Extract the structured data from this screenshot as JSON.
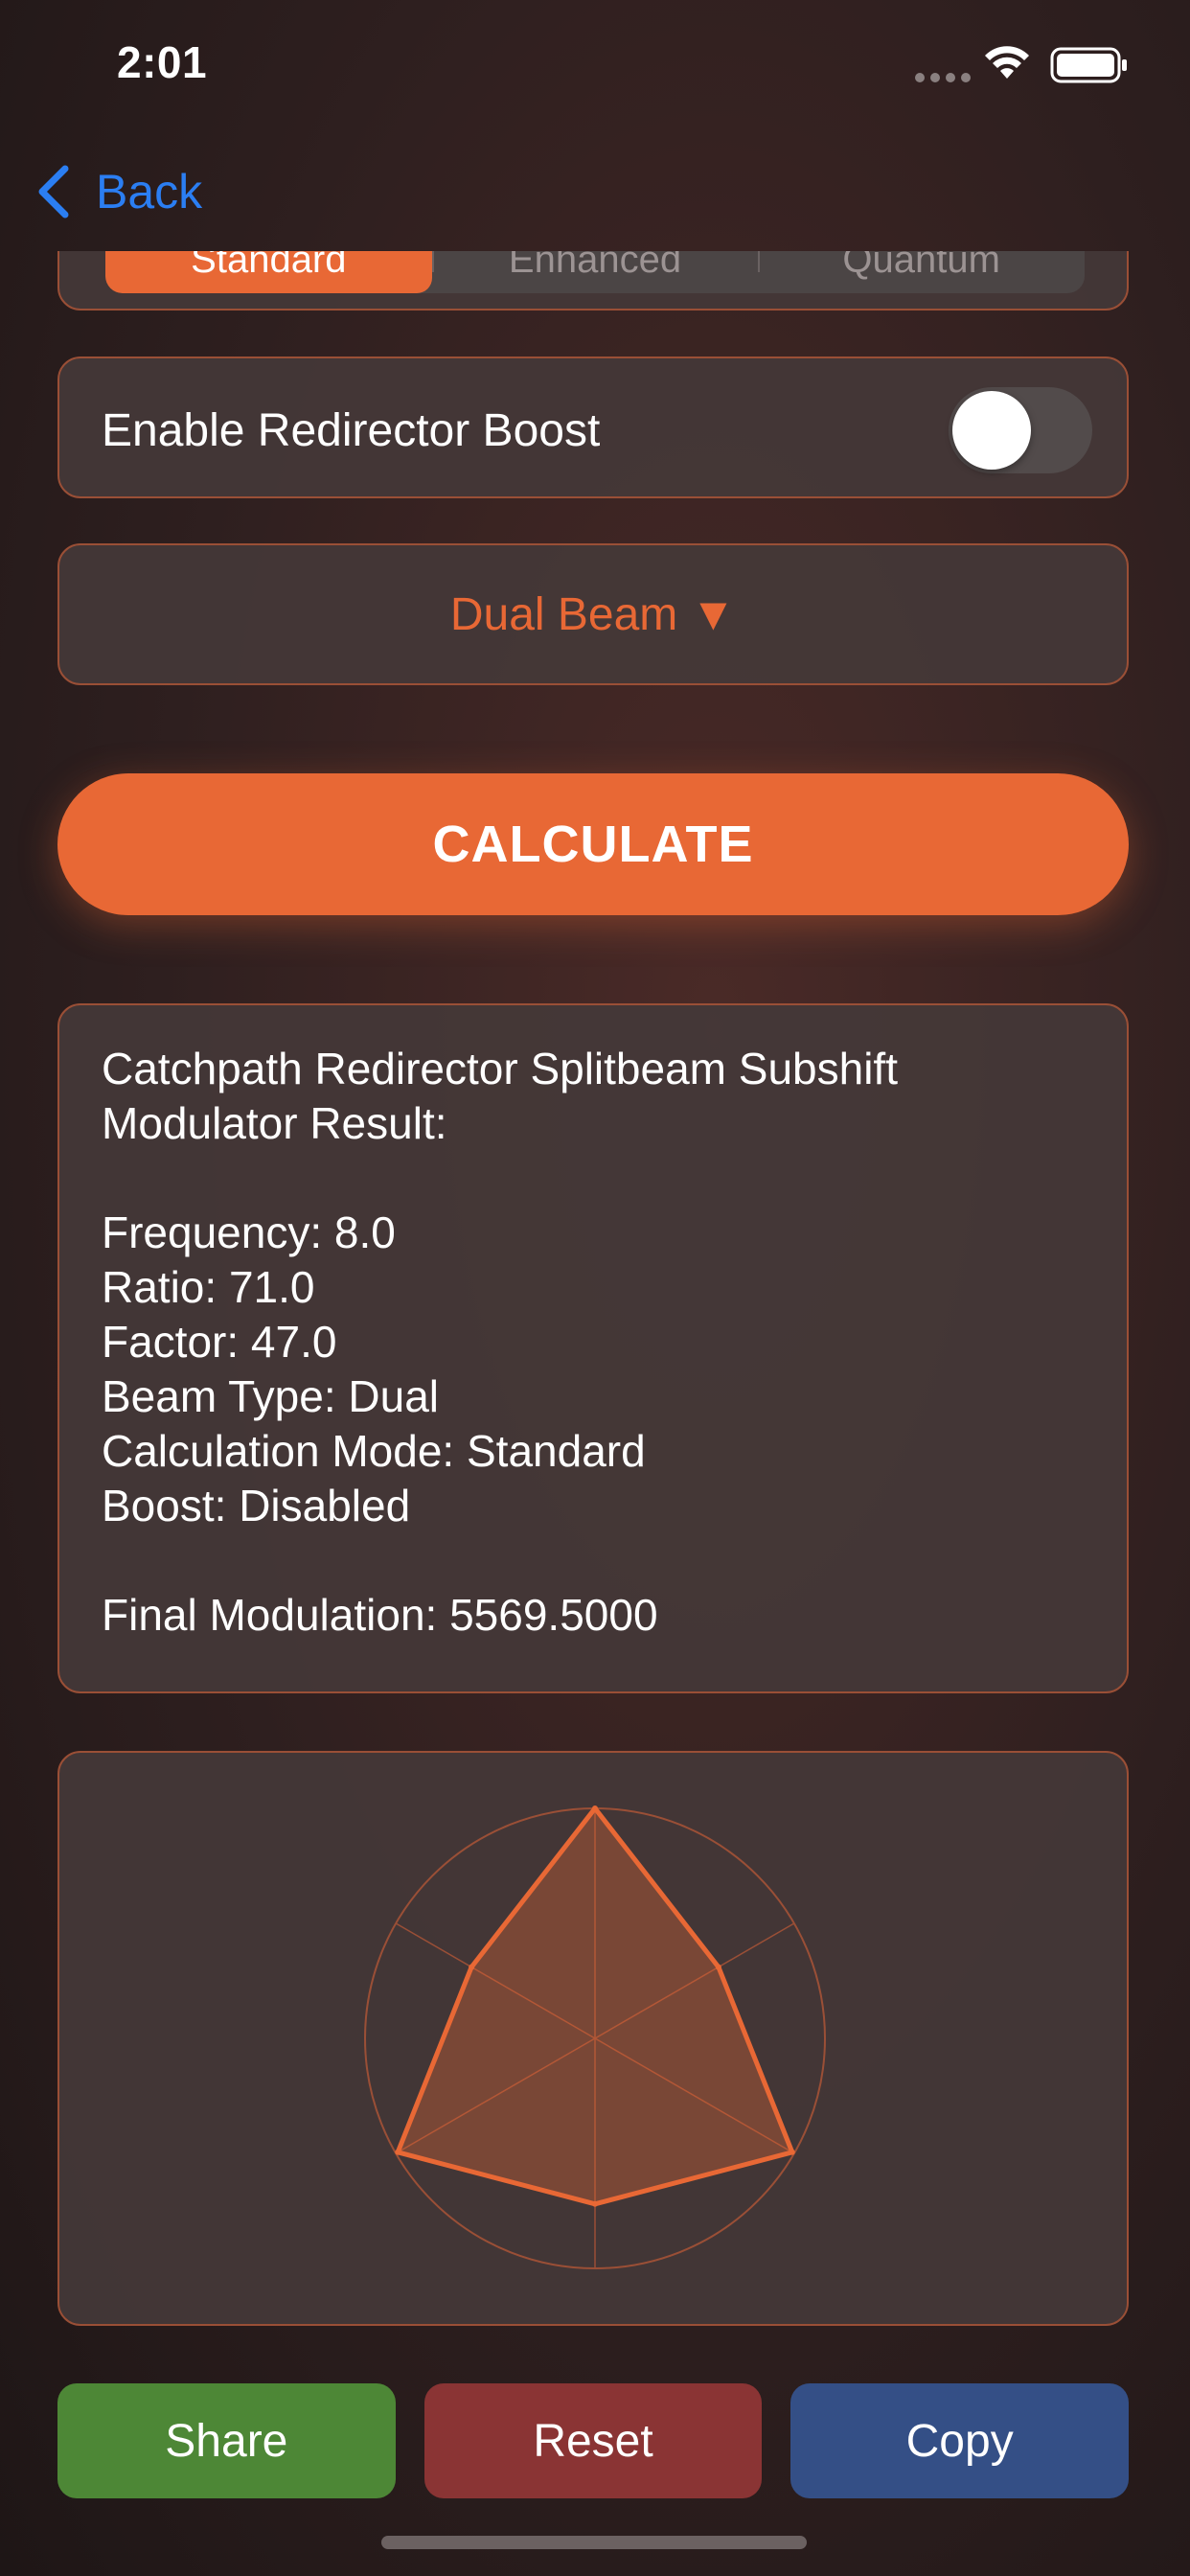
{
  "status_bar": {
    "time": "2:01"
  },
  "nav": {
    "back_label": "Back"
  },
  "segmented_control": {
    "options": [
      "Standard",
      "Enhanced",
      "Quantum"
    ],
    "selected_index": 0
  },
  "boost_toggle": {
    "label": "Enable Redirector Boost",
    "enabled": false
  },
  "beam_selector": {
    "label": "Dual Beam ▼"
  },
  "calculate_button": {
    "label": "CALCULATE"
  },
  "result": {
    "title_line1": "Catchpath Redirector Splitbeam Subshift",
    "title_line2": "Modulator Result:",
    "frequency": "Frequency: 8.0",
    "ratio": "Ratio: 71.0",
    "factor": "Factor: 47.0",
    "beam_type": "Beam Type: Dual",
    "calculation_mode": "Calculation Mode: Standard",
    "boost": "Boost: Disabled",
    "final_modulation": "Final Modulation: 5569.5000"
  },
  "chart_data": {
    "type": "radar",
    "axes_count": 6,
    "values": [
      1.0,
      0.62,
      0.99,
      0.72,
      0.99,
      0.62
    ],
    "range": [
      0,
      1
    ],
    "stroke_color": "#e86835",
    "fill_color": "#e8683555",
    "grid_color": "#9a4f36"
  },
  "bottom_buttons": {
    "share": "Share",
    "reset": "Reset",
    "copy": "Copy"
  },
  "colors": {
    "accent": "#e86835",
    "link_blue": "#2b7ef2",
    "share_green": "#4d8736",
    "reset_red": "#8a3434",
    "copy_blue": "#344f86"
  }
}
